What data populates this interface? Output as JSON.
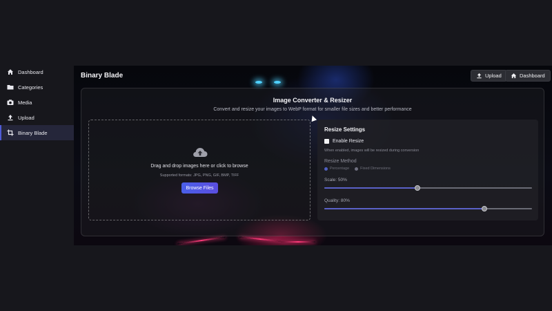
{
  "sidebar": {
    "items": [
      {
        "label": "Dashboard",
        "icon": "home-icon"
      },
      {
        "label": "Categories",
        "icon": "folder-icon"
      },
      {
        "label": "Media",
        "icon": "camera-icon"
      },
      {
        "label": "Upload",
        "icon": "upload-icon"
      },
      {
        "label": "Binary Blade",
        "icon": "crop-icon",
        "active": true
      }
    ]
  },
  "header": {
    "title": "Binary Blade",
    "upload_label": "Upload",
    "dashboard_label": "Dashboard"
  },
  "converter": {
    "title": "Image Converter & Resizer",
    "subtitle": "Convert and resize your images to WebP format for smaller file sizes and better performance"
  },
  "dropzone": {
    "text": "Drag and drop images here or click to browse",
    "formats": "Supported formats: JPG, PNG, GIF, BMP, TIFF",
    "browse_label": "Browse Files"
  },
  "settings": {
    "title": "Resize Settings",
    "enable_label": "Enable Resize",
    "enabled": false,
    "help": "When enabled, images will be resized during conversion",
    "method_label": "Resize Method",
    "method_options": [
      "Percentage",
      "Fixed Dimensions"
    ],
    "method_selected": "Percentage",
    "scale_label": "Scale: 50%",
    "scale_value": 0.45,
    "quality_label": "Quality: 80%",
    "quality_value": 0.77
  },
  "colors": {
    "accent": "#4f5bd5",
    "background": "#17171c",
    "button_gradient_start": "#4a5fe8"
  }
}
